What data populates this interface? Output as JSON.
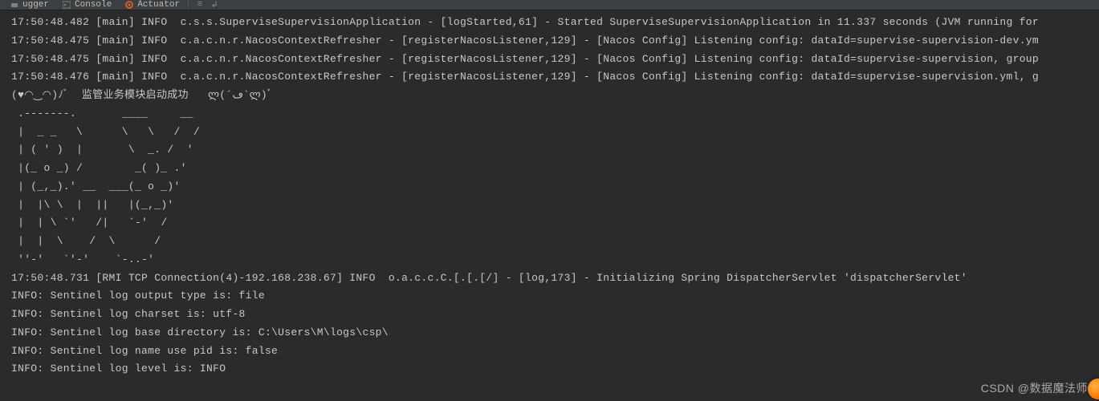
{
  "toolbar": {
    "tabs": [
      {
        "label": "ugger"
      },
      {
        "label": "Console"
      },
      {
        "label": "Actuator"
      }
    ]
  },
  "icons": {
    "debug": "debug-icon",
    "console": "console-icon",
    "actuator": "actuator-icon",
    "settings": "settings-icon"
  },
  "console": {
    "lines": [
      "17:50:48.482 [main] INFO  c.s.s.SuperviseSupervisionApplication - [logStarted,61] - Started SuperviseSupervisionApplication in 11.337 seconds (JVM running for",
      "17:50:48.475 [main] INFO  c.a.c.n.r.NacosContextRefresher - [registerNacosListener,129] - [Nacos Config] Listening config: dataId=supervise-supervision-dev.ym",
      "17:50:48.475 [main] INFO  c.a.c.n.r.NacosContextRefresher - [registerNacosListener,129] - [Nacos Config] Listening config: dataId=supervise-supervision, group",
      "17:50:48.476 [main] INFO  c.a.c.n.r.NacosContextRefresher - [registerNacosListener,129] - [Nacos Config] Listening config: dataId=supervise-supervision.yml, g",
      "(♥◠‿◠)ﾉﾞ  监管业务模块启动成功   ლ(´ڡ`ლ)ﾞ",
      " .-------.       ____     __",
      " |  _ _   \\      \\   \\   /  /",
      " | ( ' )  |       \\  _. /  '",
      " |(_ o _) /        _( )_ .'",
      " | (_,_).' __  ___(_ o _)'",
      " |  |\\ \\  |  ||   |(_,_)'",
      " |  | \\ `'   /|   `-'  /",
      " |  |  \\    /  \\      /",
      " ''-'   `'-'    `-..-'",
      "17:50:48.731 [RMI TCP Connection(4)-192.168.238.67] INFO  o.a.c.c.C.[.[.[/] - [log,173] - Initializing Spring DispatcherServlet 'dispatcherServlet'",
      "INFO: Sentinel log output type is: file",
      "INFO: Sentinel log charset is: utf-8",
      "INFO: Sentinel log base directory is: C:\\Users\\M\\logs\\csp\\",
      "INFO: Sentinel log name use pid is: false",
      "INFO: Sentinel log level is: INFO"
    ]
  },
  "watermark": {
    "text": "CSDN @数据魔法师"
  }
}
